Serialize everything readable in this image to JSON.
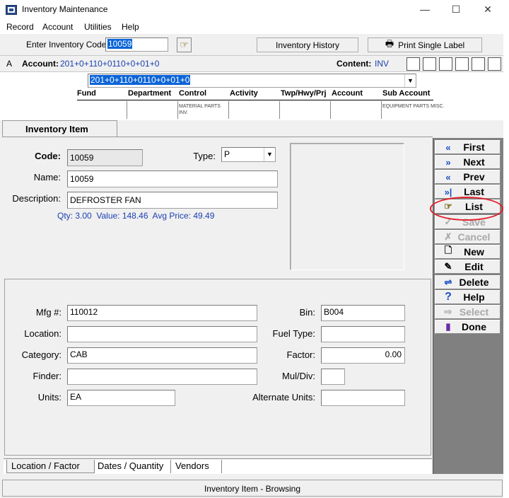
{
  "window": {
    "title": "Inventory Maintenance",
    "minimize": "—",
    "maximize": "☐",
    "close": "✕"
  },
  "menu": [
    "Record",
    "Account",
    "Utilities",
    "Help"
  ],
  "toolbar": {
    "enter_code_label": "Enter Inventory Code:",
    "enter_code_value": "10059",
    "history_button": "Inventory History",
    "print_button": "Print Single Label"
  },
  "account_bar": {
    "prefix": "A",
    "account_label": "Account:",
    "account_value": "201+0+110+0110+0+01+0",
    "content_label": "Content:",
    "content_value": "INV"
  },
  "account_select": {
    "value": "201+0+110+0110+0+01+0"
  },
  "segments": {
    "headers": [
      "Fund",
      "Department",
      "Control",
      "Activity",
      "Twp/Hwy/Prj",
      "Account",
      "Sub Account"
    ],
    "control_desc_1": "MATERIAL PARTS",
    "control_desc_2": "INV.",
    "subaccount_desc": "EQUIPMENT PARTS MISC."
  },
  "tab_title": "Inventory Item",
  "item": {
    "code_label": "Code:",
    "code_value": "10059",
    "type_label": "Type:",
    "type_value": "P",
    "name_label": "Name:",
    "name_value": "10059",
    "desc_label": "Description:",
    "desc_value": "DEFROSTER FAN",
    "qty_line": "Qty: 3.00  Value: 148.46  Avg Price: 49.49"
  },
  "details": {
    "mfg_label": "Mfg #:",
    "mfg_value": "110012",
    "location_label": "Location:",
    "location_value": "",
    "category_label": "Category:",
    "category_value": "CAB",
    "finder_label": "Finder:",
    "finder_value": "",
    "units_label": "Units:",
    "units_value": "EA",
    "bin_label": "Bin:",
    "bin_value": "B004",
    "fueltype_label": "Fuel Type:",
    "fueltype_value": "",
    "factor_label": "Factor:",
    "factor_value": "0.00",
    "muldiv_label": "Mul/Div:",
    "muldiv_value": "",
    "altunits_label": "Alternate Units:",
    "altunits_value": ""
  },
  "bottom_tabs": [
    "Location / Factor",
    "Dates / Quantity",
    "Vendors"
  ],
  "side_buttons": [
    {
      "label": "First",
      "icon": "«"
    },
    {
      "label": "Next",
      "icon": "»"
    },
    {
      "label": "Prev",
      "icon": "«"
    },
    {
      "label": "Last",
      "icon": "»|"
    },
    {
      "label": "List",
      "icon": "☞"
    },
    {
      "label": "Save",
      "icon": "✓"
    },
    {
      "label": "Cancel",
      "icon": "✗"
    },
    {
      "label": "New",
      "icon": "🗋"
    },
    {
      "label": "Edit",
      "icon": "✎"
    },
    {
      "label": "Delete",
      "icon": "⇌"
    },
    {
      "label": "Help",
      "icon": "?"
    },
    {
      "label": "Select",
      "icon": "⇨"
    },
    {
      "label": "Done",
      "icon": "▮"
    }
  ],
  "status": "Inventory Item - Browsing"
}
